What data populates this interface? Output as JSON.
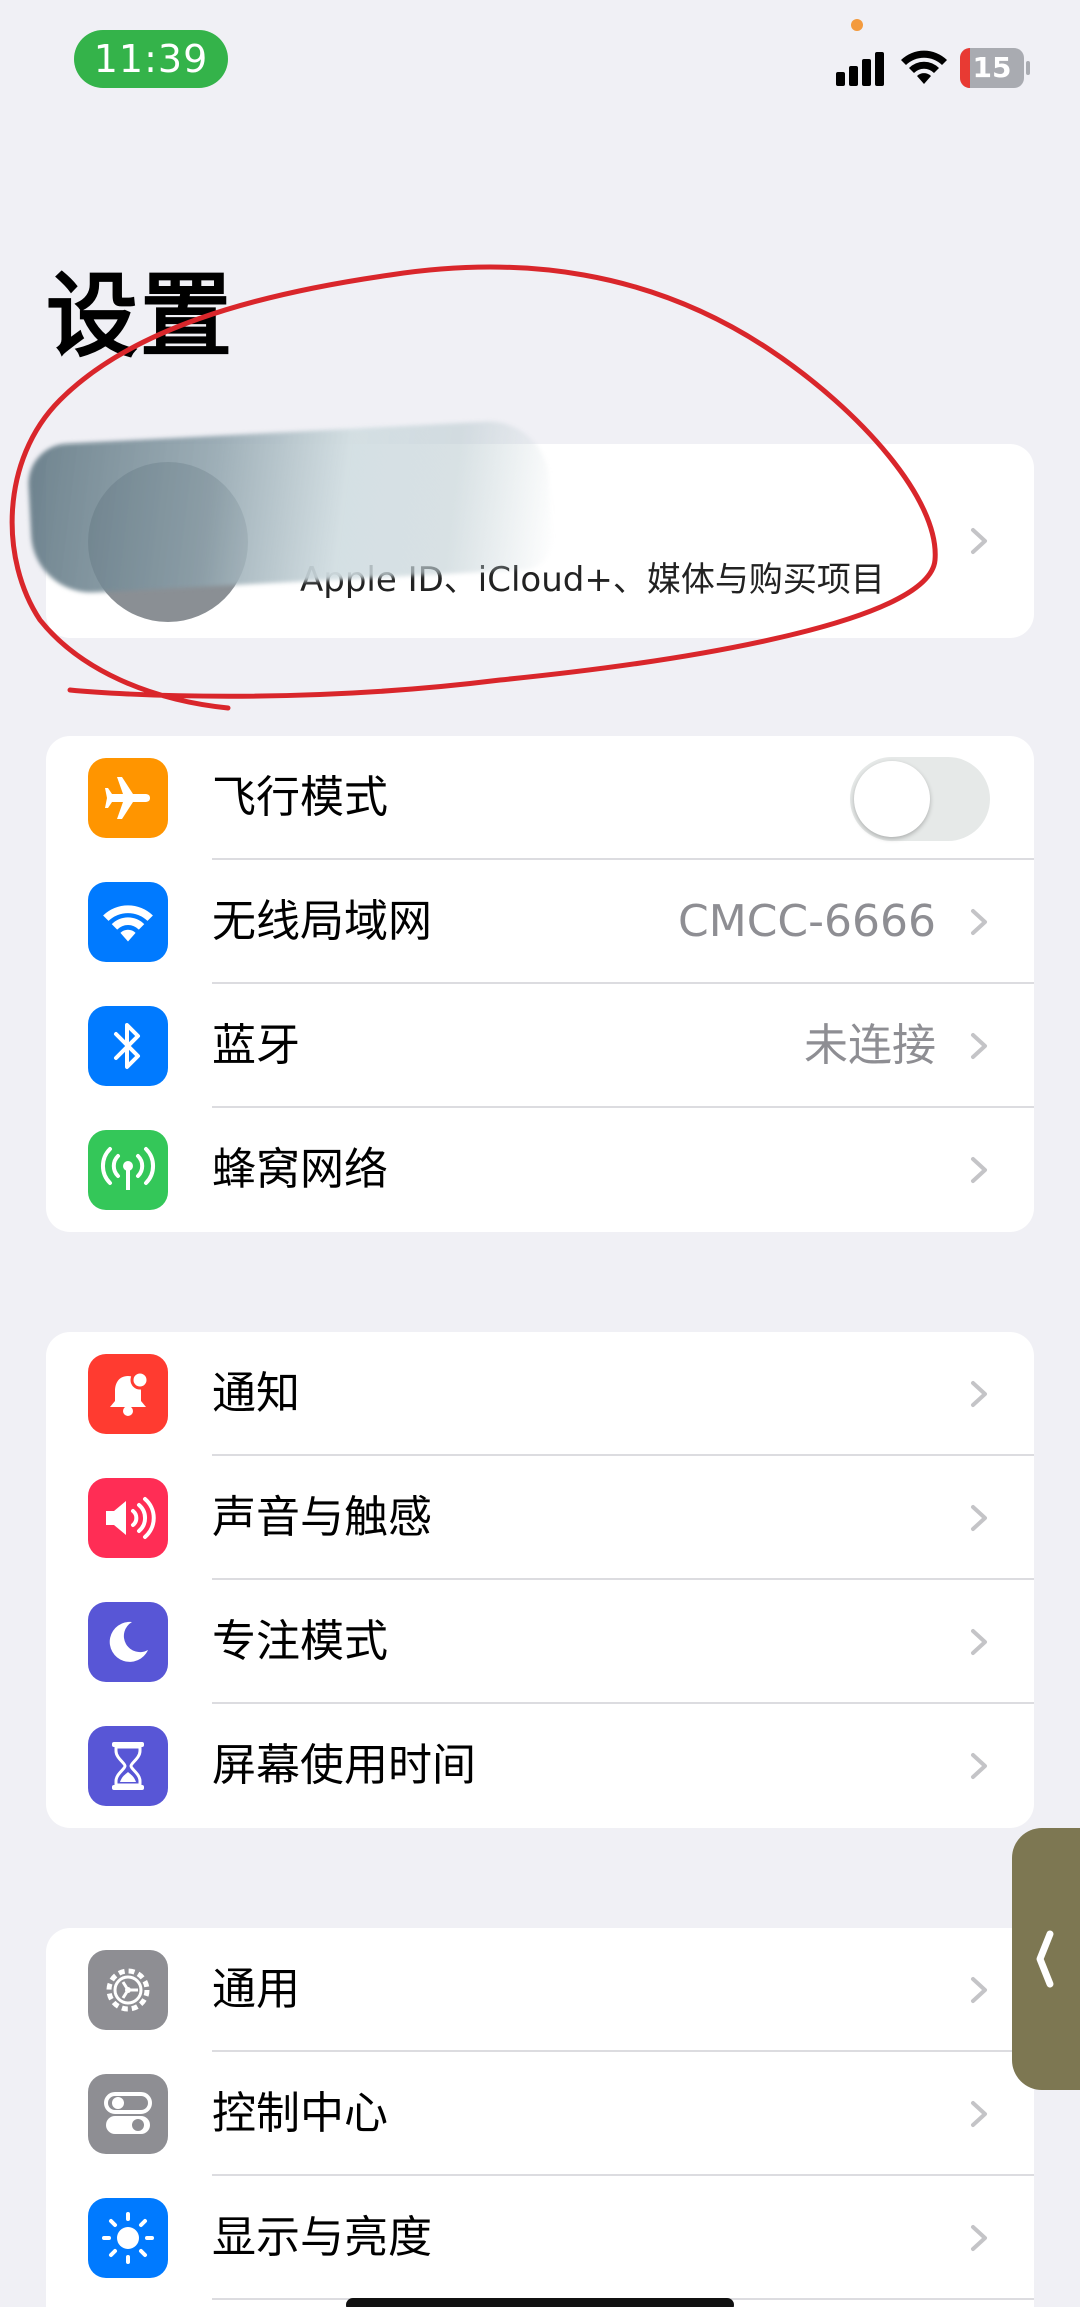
{
  "status_bar": {
    "time": "11:39",
    "battery": "15"
  },
  "page_title": "设置",
  "profile": {
    "subtitle": "Apple ID、iCloud+、媒体与购买项目"
  },
  "groups": [
    {
      "items": [
        {
          "label": "飞行模式",
          "icon": "airplane-icon",
          "color": "#ff9500",
          "toggle": false
        },
        {
          "label": "无线局域网",
          "icon": "wifi-icon",
          "color": "#007aff",
          "value": "CMCC-6666"
        },
        {
          "label": "蓝牙",
          "icon": "bluetooth-icon",
          "color": "#007aff",
          "value": "未连接"
        },
        {
          "label": "蜂窝网络",
          "icon": "cellular-icon",
          "color": "#34c759"
        }
      ]
    },
    {
      "items": [
        {
          "label": "通知",
          "icon": "bell-icon",
          "color": "#ff3b30"
        },
        {
          "label": "声音与触感",
          "icon": "speaker-icon",
          "color": "#ff2d55"
        },
        {
          "label": "专注模式",
          "icon": "moon-icon",
          "color": "#5856d6"
        },
        {
          "label": "屏幕使用时间",
          "icon": "hourglass-icon",
          "color": "#5856d6"
        }
      ]
    },
    {
      "items": [
        {
          "label": "通用",
          "icon": "gear-icon",
          "color": "#8e8e93"
        },
        {
          "label": "控制中心",
          "icon": "switches-icon",
          "color": "#8e8e93"
        },
        {
          "label": "显示与亮度",
          "icon": "sun-icon",
          "color": "#007aff"
        }
      ]
    }
  ]
}
